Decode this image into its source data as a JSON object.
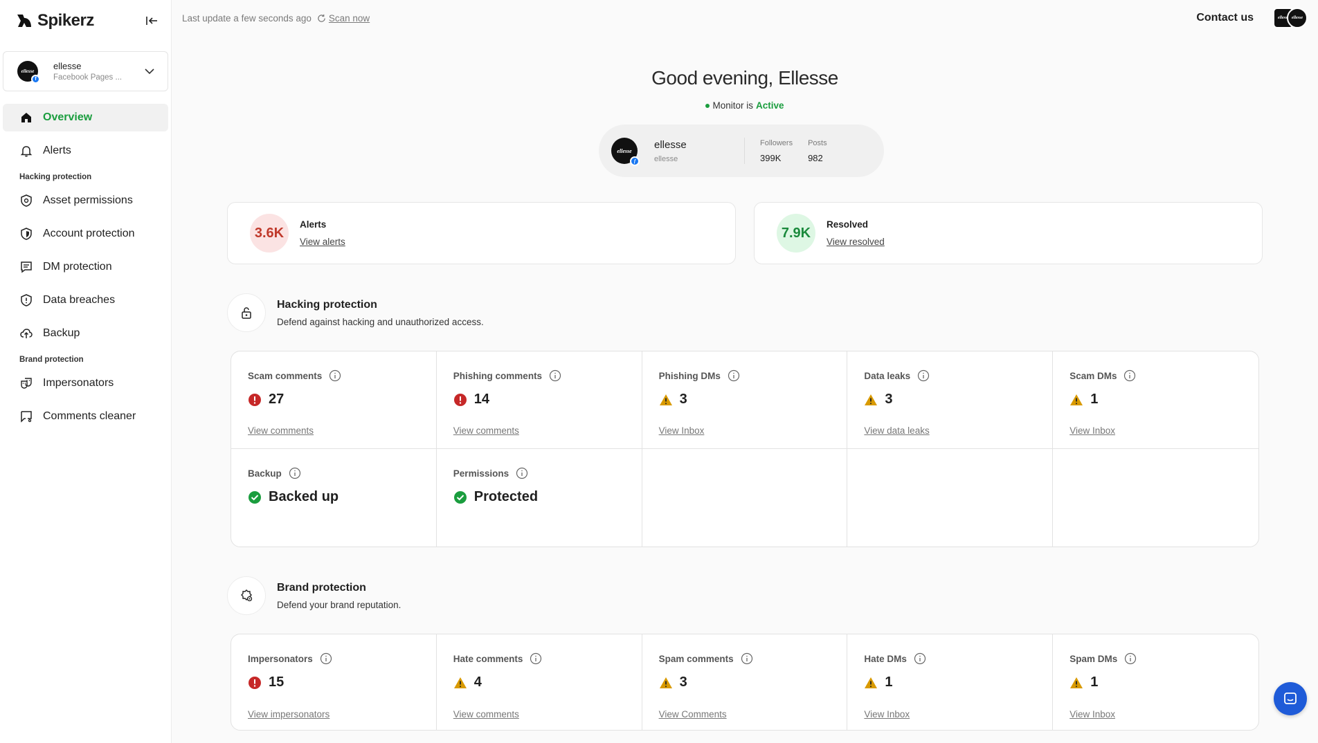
{
  "app": {
    "logo_text": "Spikerz"
  },
  "account": {
    "name": "ellesse",
    "type": "Facebook Pages ...",
    "avatar_text": "ellesse"
  },
  "sidebar": {
    "items": [
      {
        "label": "Overview",
        "icon": "home-icon",
        "active": true
      },
      {
        "label": "Alerts",
        "icon": "bell-icon"
      }
    ],
    "hacking_section": "Hacking protection",
    "hacking_items": [
      {
        "label": "Asset permissions",
        "icon": "shield-gear-icon"
      },
      {
        "label": "Account protection",
        "icon": "shield-dot-icon"
      },
      {
        "label": "DM protection",
        "icon": "message-icon"
      },
      {
        "label": "Data breaches",
        "icon": "shield-alert-icon"
      },
      {
        "label": "Backup",
        "icon": "cloud-upload-icon"
      }
    ],
    "brand_section": "Brand protection",
    "brand_items": [
      {
        "label": "Impersonators",
        "icon": "masks-icon"
      },
      {
        "label": "Comments cleaner",
        "icon": "comment-clean-icon"
      }
    ]
  },
  "topbar": {
    "last_update": "Last update a few seconds ago",
    "scan_now": "Scan now",
    "contact": "Contact us"
  },
  "greeting": "Good evening, Ellesse",
  "monitor": {
    "prefix": "Monitor is",
    "status": "Active"
  },
  "profile": {
    "name": "ellesse",
    "handle": "ellesse",
    "followers_label": "Followers",
    "followers": "399K",
    "posts_label": "Posts",
    "posts": "982"
  },
  "summary": {
    "alerts": {
      "count": "3.6K",
      "title": "Alerts",
      "link": "View alerts"
    },
    "resolved": {
      "count": "7.9K",
      "title": "Resolved",
      "link": "View resolved"
    }
  },
  "hacking": {
    "title": "Hacking protection",
    "desc": "Defend against hacking and unauthorized access.",
    "cells": [
      {
        "title": "Scam comments",
        "status": "error",
        "value": "27",
        "link": "View comments"
      },
      {
        "title": "Phishing comments",
        "status": "error",
        "value": "14",
        "link": "View comments"
      },
      {
        "title": "Phishing DMs",
        "status": "warning",
        "value": "3",
        "link": "View Inbox"
      },
      {
        "title": "Data leaks",
        "status": "warning",
        "value": "3",
        "link": "View data leaks"
      },
      {
        "title": "Scam DMs",
        "status": "warning",
        "value": "1",
        "link": "View Inbox"
      },
      {
        "title": "Backup",
        "status": "ok",
        "value": "Backed up",
        "link": ""
      },
      {
        "title": "Permissions",
        "status": "ok",
        "value": "Protected",
        "link": ""
      }
    ]
  },
  "brand": {
    "title": "Brand protection",
    "desc": "Defend your brand reputation.",
    "cells": [
      {
        "title": "Impersonators",
        "status": "error",
        "value": "15",
        "link": "View impersonators"
      },
      {
        "title": "Hate comments",
        "status": "warning",
        "value": "4",
        "link": "View comments"
      },
      {
        "title": "Spam comments",
        "status": "warning",
        "value": "3",
        "link": "View Comments"
      },
      {
        "title": "Hate DMs",
        "status": "warning",
        "value": "1",
        "link": "View Inbox"
      },
      {
        "title": "Spam DMs",
        "status": "warning",
        "value": "1",
        "link": "View Inbox"
      }
    ]
  },
  "colors": {
    "error": "#c62828",
    "warning": "#d99a00",
    "ok": "#1a9d3e",
    "accent": "#1f5bd8"
  }
}
